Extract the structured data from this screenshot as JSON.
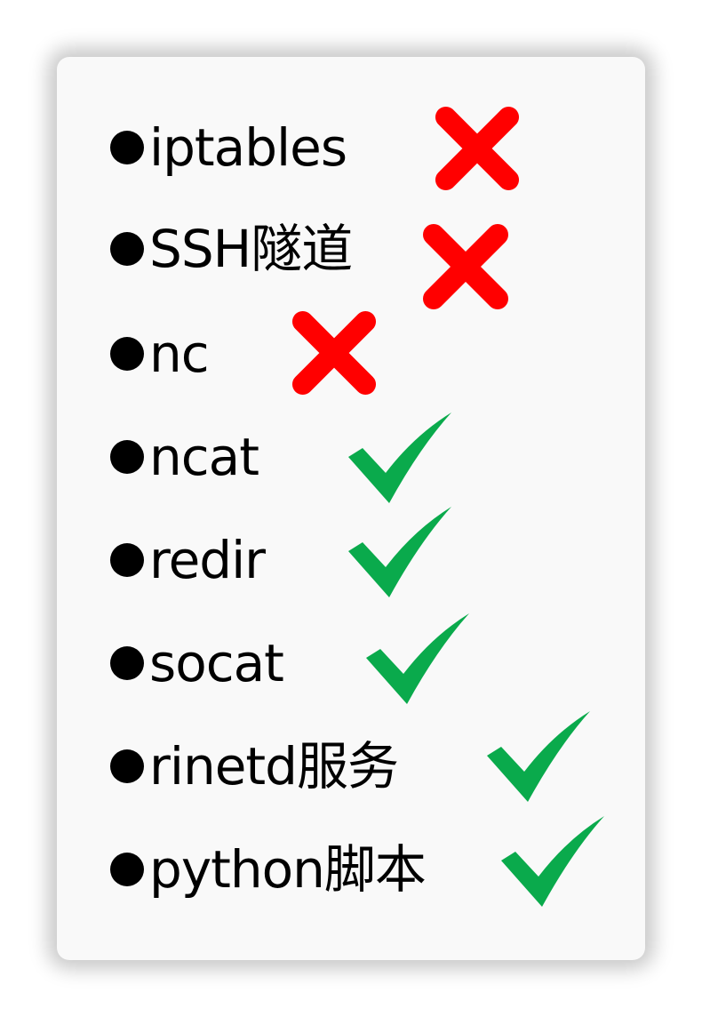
{
  "colors": {
    "cross": "#ff0000",
    "check": "#0aaa4c",
    "text": "#000000",
    "card": "#f9f9f9"
  },
  "items": [
    {
      "label": "iptables",
      "status": "unsupported",
      "icon": "cross-icon"
    },
    {
      "label": "SSH隧道",
      "status": "unsupported",
      "icon": "cross-icon"
    },
    {
      "label": "nc",
      "status": "unsupported",
      "icon": "cross-icon"
    },
    {
      "label": "ncat",
      "status": "supported",
      "icon": "check-icon"
    },
    {
      "label": "redir",
      "status": "supported",
      "icon": "check-icon"
    },
    {
      "label": "socat",
      "status": "supported",
      "icon": "check-icon"
    },
    {
      "label": "rinetd服务",
      "status": "supported",
      "icon": "check-icon"
    },
    {
      "label": "python脚本",
      "status": "supported",
      "icon": "check-icon"
    }
  ]
}
